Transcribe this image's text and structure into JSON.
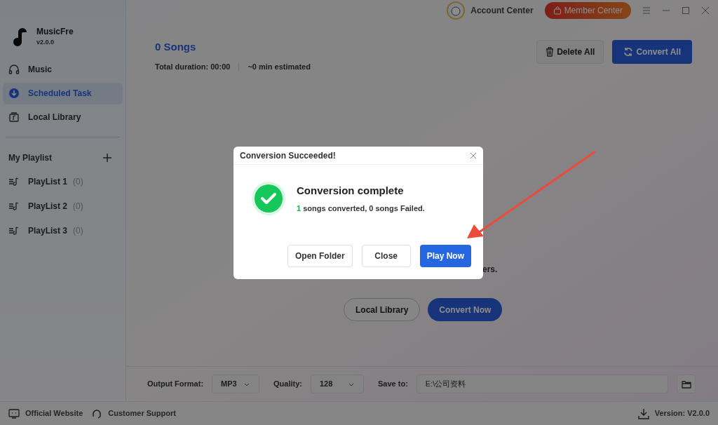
{
  "app": {
    "name": "MusicFre",
    "version": "v2.0.0"
  },
  "nav": [
    {
      "label": "Music",
      "selected": false
    },
    {
      "label": "Scheduled Task",
      "selected": true
    },
    {
      "label": "Local Library",
      "selected": false
    }
  ],
  "playlist_header": "My Playlist",
  "playlists": [
    {
      "label": "PlayList 1",
      "count": "(0)"
    },
    {
      "label": "PlayList 2",
      "count": "(0)"
    },
    {
      "label": "PlayList 3",
      "count": "(0)"
    }
  ],
  "header": {
    "account": "Account Center",
    "member": "Member Center"
  },
  "summary": {
    "title": "0 Songs",
    "duration": "Total duration: 00:00",
    "estimate": "~0 min estimated"
  },
  "actions": {
    "delete": "Delete All",
    "convert": "Convert All"
  },
  "empty_state": {
    "hint_tail": "ers.",
    "buttons": [
      "Local Library",
      "Convert Now"
    ]
  },
  "settings": {
    "format_label": "Output Format:",
    "format": "MP3",
    "quality_label": "Quality:",
    "quality": "128",
    "save_label": "Save to:",
    "save_path": "E:\\公司资料"
  },
  "footer": {
    "website": "Official Website",
    "support": "Customer Support",
    "version": "Version: V2.0.0"
  },
  "dialog": {
    "title": "Conversion Succeeded!",
    "heading": "Conversion complete",
    "message": "1",
    "message_rest": " songs converted, 0 songs Failed.",
    "buttons": [
      {
        "label": "Open Folder",
        "kind": "secondary"
      },
      {
        "label": "Close",
        "kind": "secondary"
      },
      {
        "label": "Play Now",
        "kind": "primary"
      }
    ]
  }
}
